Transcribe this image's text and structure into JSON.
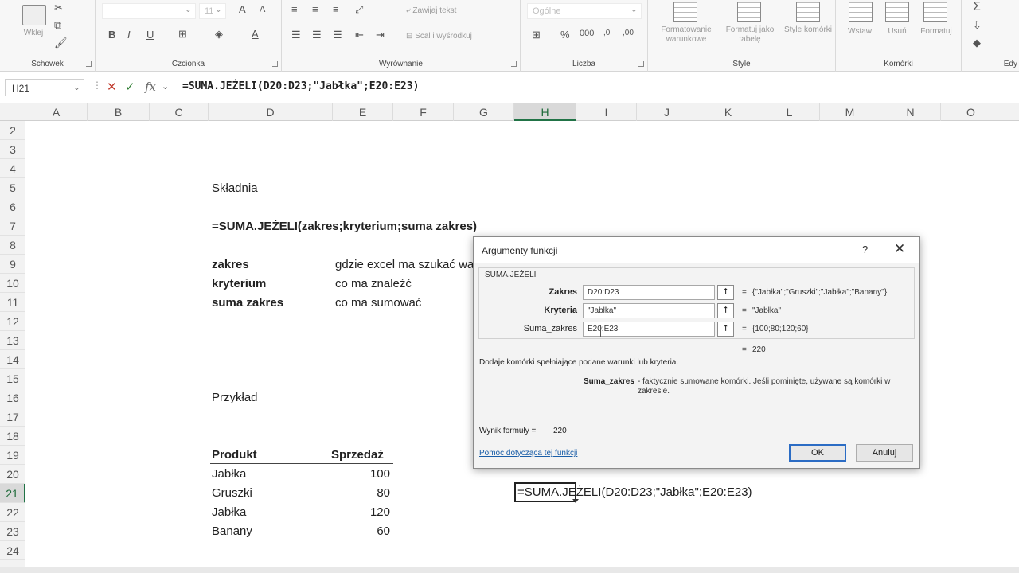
{
  "ribbon": {
    "groups": {
      "clipboard": "Schowek",
      "font": "Czcionka",
      "alignment": "Wyrównanie",
      "number": "Liczba",
      "styles": "Style",
      "cells": "Komórki",
      "editing": "Edy"
    },
    "paste_label": "Wklej",
    "wrap_text": "Zawijaj tekst",
    "merge_center": "Scal i wyśrodkuj",
    "number_format": "Ogólne",
    "font_size": "11",
    "conditional_formatting": "Formatowanie warunkowe",
    "format_as_table": "Formatuj jako tabelę",
    "cell_styles": "Style komórki",
    "insert": "Wstaw",
    "delete": "Usuń",
    "format": "Formatuj",
    "bold": "B",
    "italic": "I",
    "underline": "U",
    "grow_font": "A",
    "shrink_font": "A",
    "font_color": "A",
    "percent": "%",
    "sum": "Σ"
  },
  "formula_bar": {
    "name_box": "H21",
    "fx_label": "fx",
    "formula": "=SUMA.JEŻELI(D20:D23;\"Jabłka\";E20:E23)"
  },
  "columns": [
    "A",
    "B",
    "C",
    "D",
    "E",
    "F",
    "G",
    "H",
    "I",
    "J",
    "K",
    "L",
    "M",
    "N",
    "O"
  ],
  "rows": [
    "2",
    "3",
    "4",
    "5",
    "6",
    "7",
    "8",
    "9",
    "10",
    "11",
    "12",
    "13",
    "14",
    "15",
    "16",
    "17",
    "18",
    "19",
    "20",
    "21",
    "22",
    "23",
    "24"
  ],
  "sheet": {
    "skladnia": "Składnia",
    "syntax_formula": "=SUMA.JEŻELI(zakres;kryterium;suma zakres)",
    "args": [
      {
        "name": "zakres",
        "desc": "gdzie excel ma szukać wa"
      },
      {
        "name": "kryterium",
        "desc": "co ma znaleźć"
      },
      {
        "name": "suma zakres",
        "desc": "co ma sumować"
      }
    ],
    "przyklad": "Przykład",
    "table_header": {
      "product": "Produkt",
      "sales": "Sprzedaż"
    },
    "table_rows": [
      {
        "product": "Jabłka",
        "sales": "100"
      },
      {
        "product": "Gruszki",
        "sales": "80"
      },
      {
        "product": "Jabłka",
        "sales": "120"
      },
      {
        "product": "Banany",
        "sales": "60"
      }
    ],
    "active_cell_text": "=SUMA.JEŻELI(D20:D23;\"Jabłka\";E20:E23)"
  },
  "dialog": {
    "title": "Argumenty funkcji",
    "help": "?",
    "close": "✕",
    "function_name": "SUMA.JEŻELI",
    "args": [
      {
        "label": "Zakres",
        "value": "D20:D23",
        "result": "{\"Jabłka\";\"Gruszki\";\"Jabłka\";\"Banany\"}"
      },
      {
        "label": "Kryteria",
        "value": "\"Jabłka\"",
        "result": "\"Jabłka\""
      },
      {
        "label": "Suma_zakres",
        "value": "E20:E23",
        "result": "{100;80;120;60}"
      }
    ],
    "total": "220",
    "description": "Dodaje komórki spełniające podane warunki lub kryteria.",
    "param_name": "Suma_zakres",
    "param_desc": "- faktycznie sumowane komórki. Jeśli pominięte, używane są komórki w zakresie.",
    "result_label": "Wynik formuły =",
    "result_value": "220",
    "help_link": "Pomoc dotycząca tej funkcji",
    "ok": "OK",
    "cancel": "Anuluj"
  }
}
